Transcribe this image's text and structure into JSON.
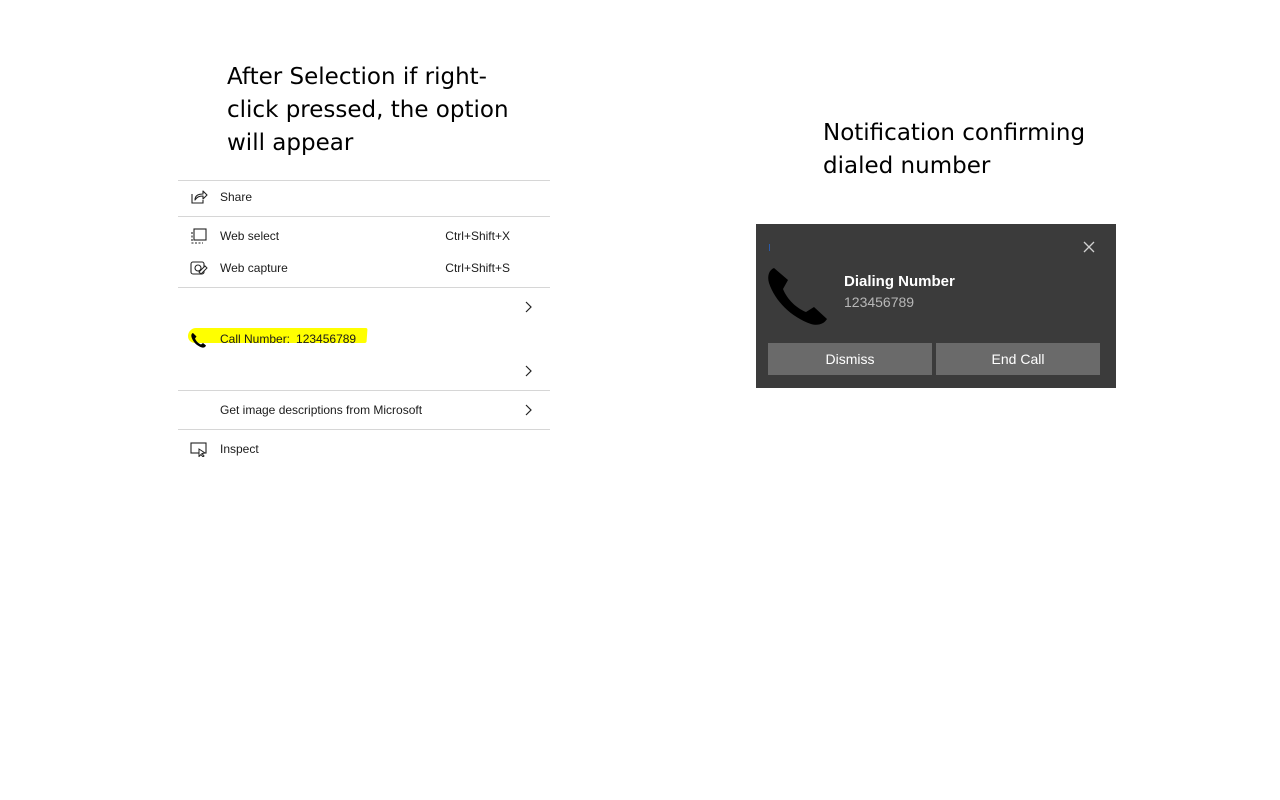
{
  "captions": {
    "left": "After Selection if right-click pressed, the option will appear",
    "right": "Notification confirming dialed number"
  },
  "context_menu": {
    "items": [
      {
        "id": "share",
        "label": "Share",
        "icon": "share-icon"
      },
      {
        "id": "web-select",
        "label": "Web select",
        "shortcut": "Ctrl+Shift+X",
        "icon": "web-select-icon"
      },
      {
        "id": "web-capture",
        "label": "Web capture",
        "shortcut": "Ctrl+Shift+S",
        "icon": "web-capture-icon"
      },
      {
        "id": "submenu-blank-1",
        "label": "",
        "icon": "chevron-right-icon"
      },
      {
        "id": "call-number",
        "label": "Call Number:",
        "value": "123456789",
        "icon": "phone-icon",
        "highlight_color": "#ffff00"
      },
      {
        "id": "submenu-blank-2",
        "label": "",
        "icon": "chevron-right-icon"
      },
      {
        "id": "image-descriptions",
        "label": "Get image descriptions from Microsoft",
        "icon": "chevron-right-icon"
      },
      {
        "id": "inspect",
        "label": "Inspect",
        "icon": "inspect-icon"
      }
    ]
  },
  "notification": {
    "title": "Dialing Number",
    "number": "123456789",
    "buttons": {
      "dismiss": "Dismiss",
      "end_call": "End Call"
    },
    "icons": [
      "phone-icon",
      "close-icon"
    ],
    "background": "#3b3b3b",
    "button_color": "#6a6a6a"
  }
}
